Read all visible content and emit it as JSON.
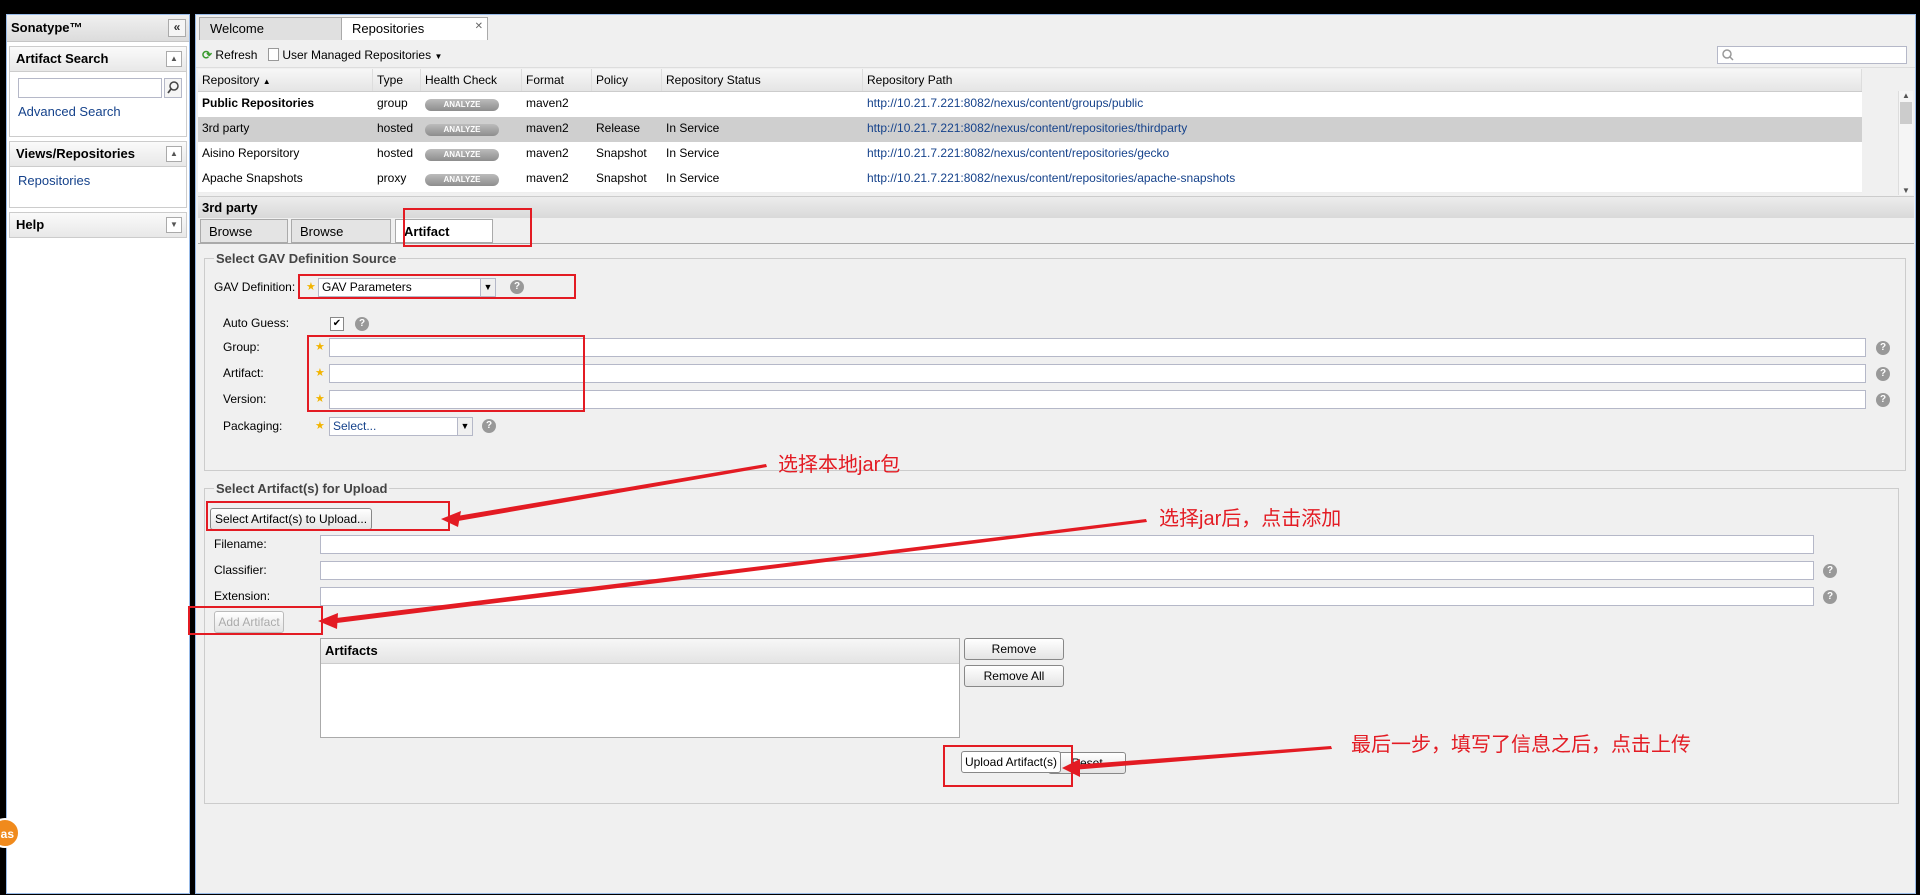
{
  "app": {
    "brand": "Sonatype™",
    "collapse_glyph": "«"
  },
  "sidebar": {
    "artifact_search": {
      "title": "Artifact Search",
      "link": "Advanced Search",
      "search_icon": "search-icon"
    },
    "views": {
      "title": "Views/Repositories",
      "link": "Repositories"
    },
    "help": {
      "title": "Help"
    }
  },
  "tabs": [
    {
      "label": "Welcome"
    },
    {
      "label": "Repositories"
    }
  ],
  "toolbar": {
    "refresh": "Refresh",
    "managed": "User Managed Repositories"
  },
  "grid": {
    "columns": [
      "Repository",
      "Type",
      "Health Check",
      "Format",
      "Policy",
      "Repository Status",
      "Repository Path"
    ],
    "analyze_label": "ANALYZE",
    "rows": [
      {
        "name": "Public Repositories",
        "type": "group",
        "format": "maven2",
        "policy": "",
        "status": "",
        "path": "http://10.21.7.221:8082/nexus/content/groups/public"
      },
      {
        "name": "3rd party",
        "type": "hosted",
        "format": "maven2",
        "policy": "Release",
        "status": "In Service",
        "path": "http://10.21.7.221:8082/nexus/content/repositories/thirdparty"
      },
      {
        "name": "Aisino Reporsitory",
        "type": "hosted",
        "format": "maven2",
        "policy": "Snapshot",
        "status": "In Service",
        "path": "http://10.21.7.221:8082/nexus/content/repositories/gecko"
      },
      {
        "name": "Apache Snapshots",
        "type": "proxy",
        "format": "maven2",
        "policy": "Snapshot",
        "status": "In Service",
        "path": "http://10.21.7.221:8082/nexus/content/repositories/apache-snapshots"
      }
    ]
  },
  "detail": {
    "title": "3rd party",
    "subtabs": [
      "Browse Index",
      "Browse Storage",
      "Artifact Upload"
    ],
    "gav": {
      "legend": "Select GAV Definition Source",
      "definition_label": "GAV Definition:",
      "definition_value": "GAV Parameters",
      "auto_guess_label": "Auto Guess:",
      "group_label": "Group:",
      "artifact_label": "Artifact:",
      "version_label": "Version:",
      "packaging_label": "Packaging:",
      "packaging_value": "Select..."
    },
    "upload": {
      "legend": "Select Artifact(s) for Upload",
      "select_button": "Select Artifact(s) to Upload...",
      "filename_label": "Filename:",
      "classifier_label": "Classifier:",
      "extension_label": "Extension:",
      "add_button": "Add Artifact",
      "artifacts_title": "Artifacts",
      "remove": "Remove",
      "remove_all": "Remove All",
      "upload_button": "Upload Artifact(s)",
      "reset": "Reset"
    }
  },
  "annotations": {
    "a1": "选择本地jar包",
    "a2": "选择jar后，点击添加",
    "a3": "最后一步，填写了信息之后，点击上传"
  },
  "badge": "as",
  "colors": {
    "annotation": "#e31b23",
    "link": "#15428b",
    "required_star": "#f2b400"
  }
}
